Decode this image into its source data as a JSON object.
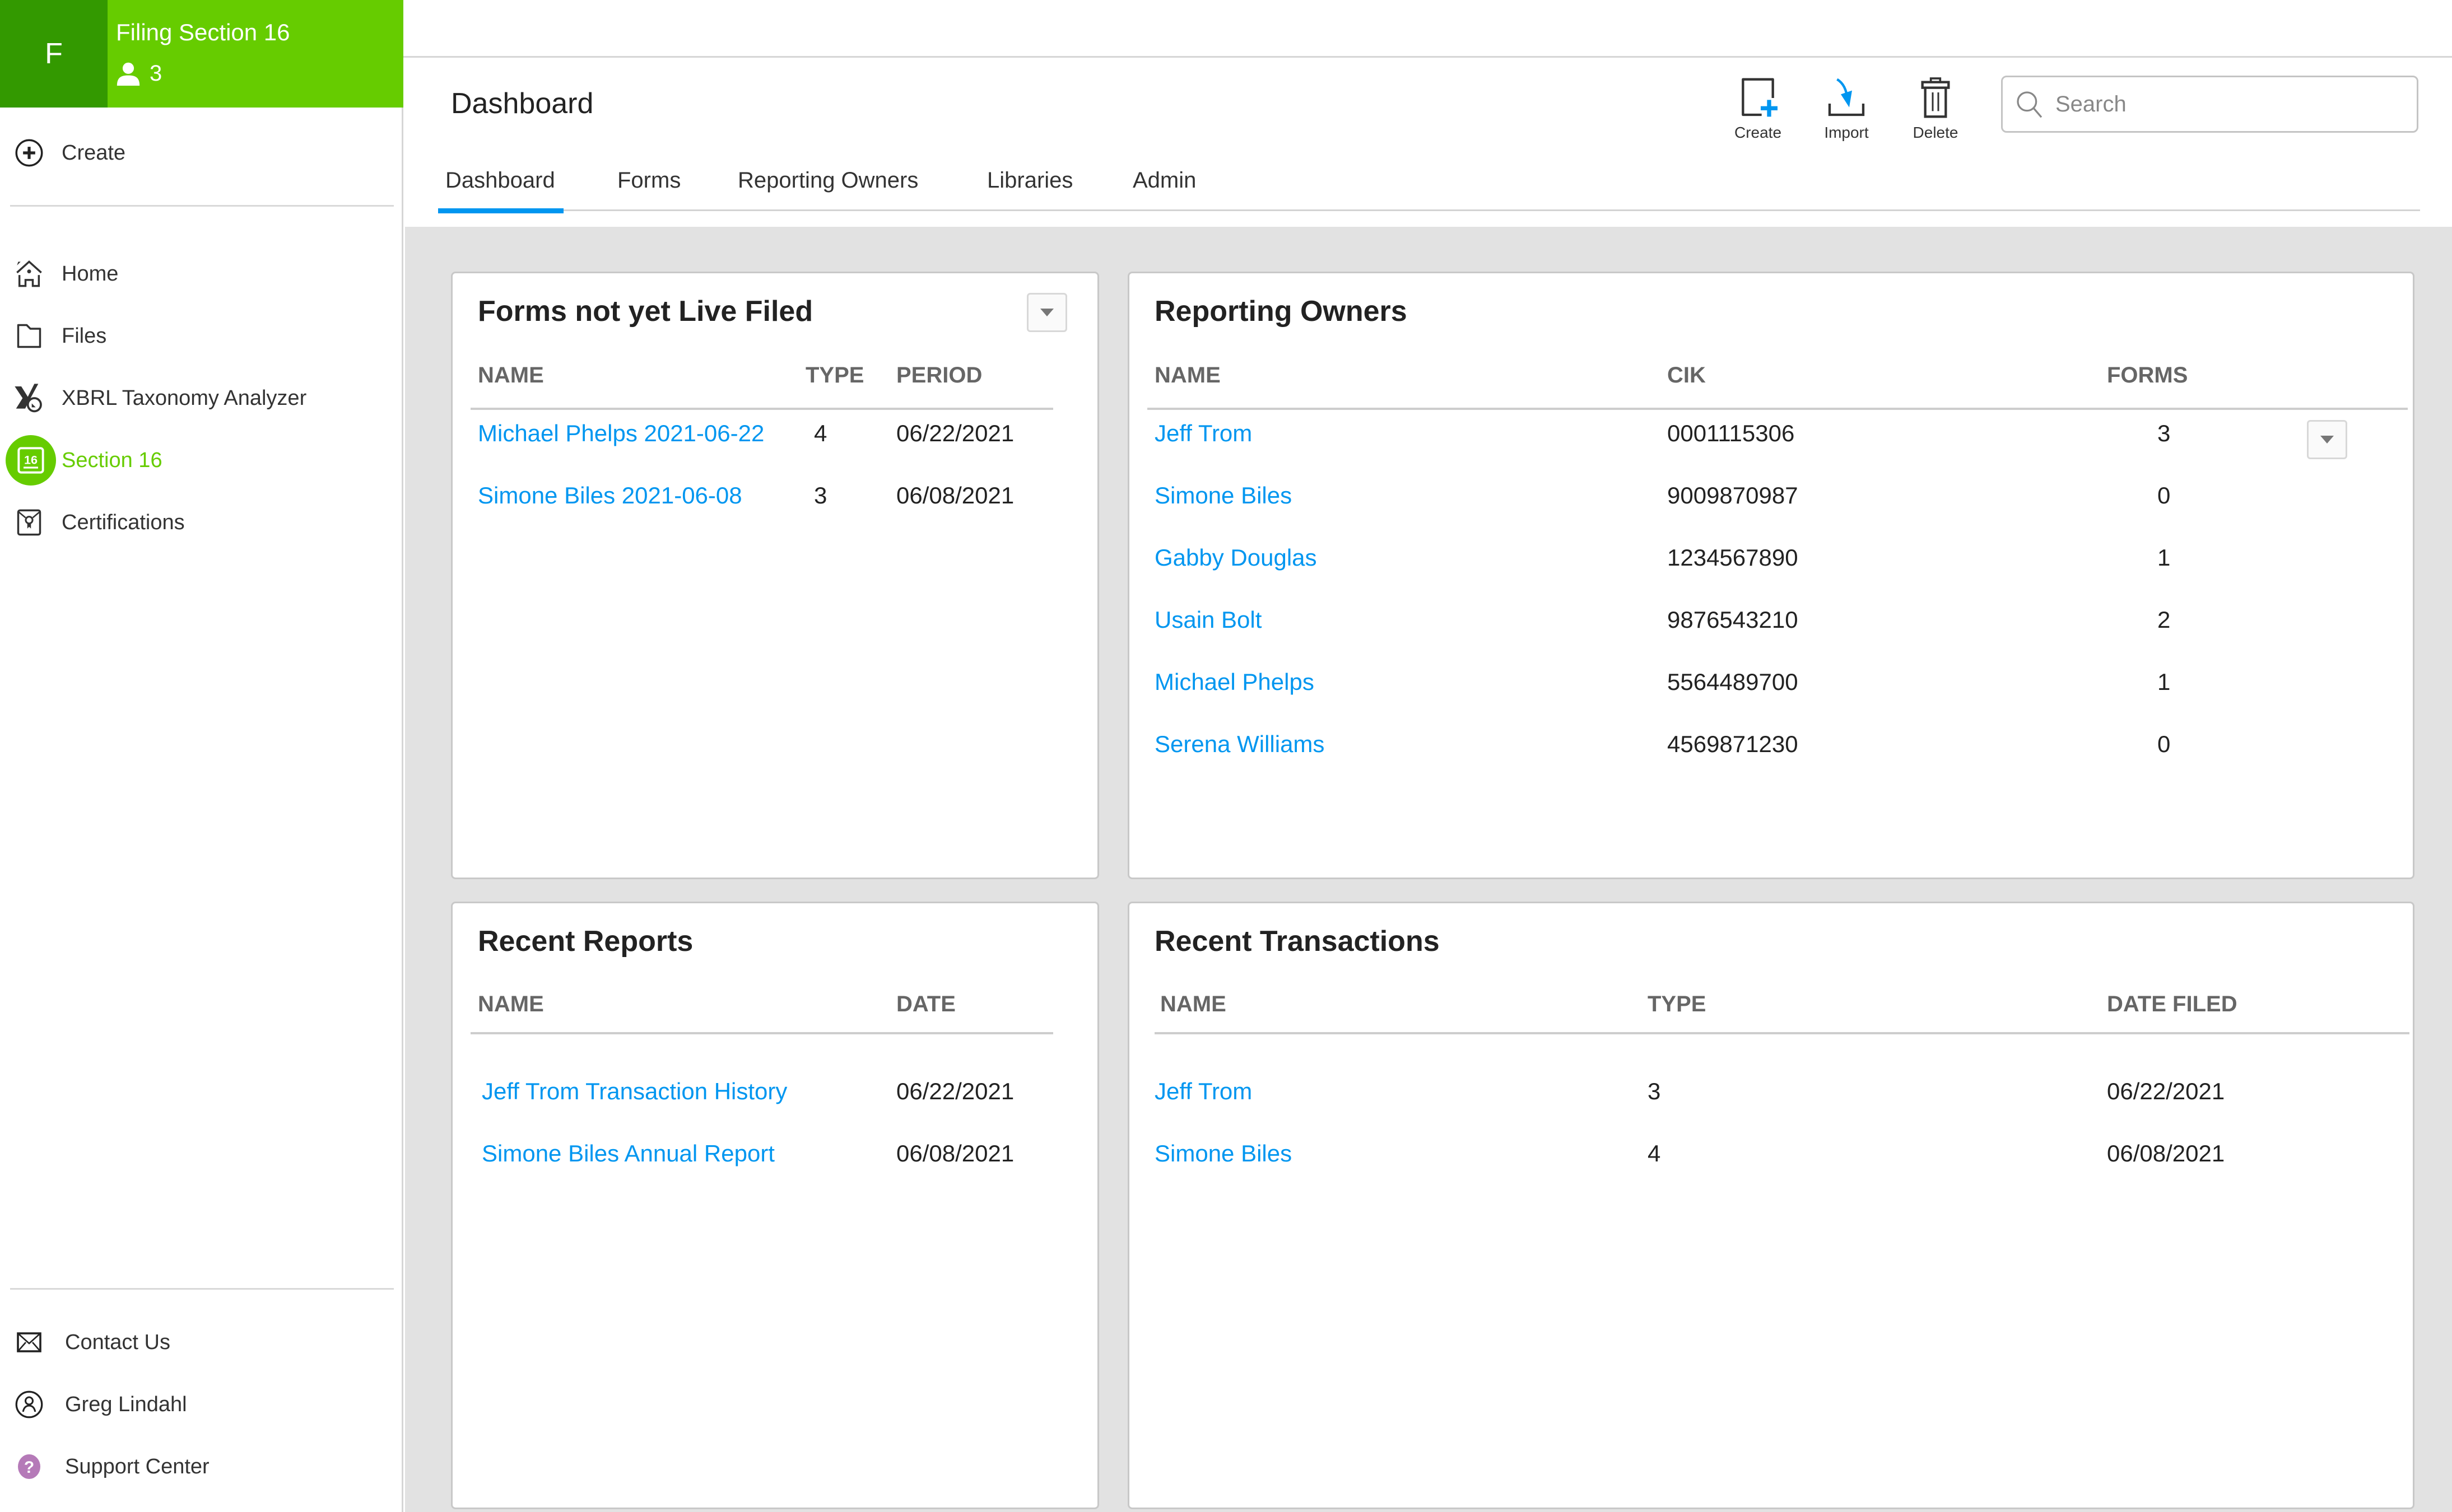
{
  "brand": {
    "letter": "F",
    "title": "Filing Section 16",
    "user_count": "3",
    "colors": {
      "dark": "#339900",
      "light": "#66cc00"
    }
  },
  "sidebar": {
    "create_label": "Create",
    "items": [
      {
        "label": "Home",
        "icon": "home-icon"
      },
      {
        "label": "Files",
        "icon": "folder-icon"
      },
      {
        "label": "XBRL Taxonomy Analyzer",
        "icon": "xbrl-analyzer-icon"
      },
      {
        "label": "Section 16",
        "icon": "section-16-icon",
        "active": true
      },
      {
        "label": "Certifications",
        "icon": "certificate-icon"
      }
    ],
    "footer": [
      {
        "label": "Contact Us",
        "icon": "envelope-icon"
      },
      {
        "label": "Greg Lindahl",
        "icon": "user-circle-icon"
      },
      {
        "label": "Support Center",
        "icon": "help-icon"
      }
    ]
  },
  "header": {
    "title": "Dashboard",
    "toolbar": {
      "create": "Create",
      "import": "Import",
      "delete": "Delete"
    },
    "search_placeholder": "Search",
    "tabs": [
      "Dashboard",
      "Forms",
      "Reporting Owners",
      "Libraries",
      "Admin"
    ],
    "active_tab": "Dashboard",
    "accent": "#0096f0"
  },
  "panels": {
    "forms_not_filed": {
      "title": "Forms not yet Live Filed",
      "columns": [
        "NAME",
        "TYPE",
        "PERIOD"
      ],
      "rows": [
        {
          "name": "Michael Phelps 2021-06-22",
          "type": "4",
          "period": "06/22/2021"
        },
        {
          "name": "Simone Biles 2021-06-08",
          "type": "3",
          "period": "06/08/2021"
        }
      ]
    },
    "reporting_owners": {
      "title": "Reporting Owners",
      "columns": [
        "NAME",
        "CIK",
        "FORMS"
      ],
      "rows": [
        {
          "name": "Jeff Trom",
          "cik": "0001115306",
          "forms": "3"
        },
        {
          "name": "Simone Biles",
          "cik": "9009870987",
          "forms": "0"
        },
        {
          "name": "Gabby Douglas",
          "cik": "1234567890",
          "forms": "1"
        },
        {
          "name": "Usain Bolt",
          "cik": "9876543210",
          "forms": "2"
        },
        {
          "name": "Michael Phelps",
          "cik": "5564489700",
          "forms": "1"
        },
        {
          "name": "Serena Williams",
          "cik": "4569871230",
          "forms": "0"
        }
      ]
    },
    "recent_reports": {
      "title": "Recent Reports",
      "columns": [
        "NAME",
        "DATE"
      ],
      "rows": [
        {
          "name": "Jeff Trom Transaction History",
          "date": "06/22/2021"
        },
        {
          "name": "Simone Biles Annual Report",
          "date": "06/08/2021"
        }
      ]
    },
    "recent_transactions": {
      "title": "Recent Transactions",
      "columns": [
        "NAME",
        "TYPE",
        "DATE FILED"
      ],
      "rows": [
        {
          "name": "Jeff Trom",
          "type": "3",
          "date_filed": "06/22/2021"
        },
        {
          "name": "Simone Biles",
          "type": "4",
          "date_filed": "06/08/2021"
        }
      ]
    }
  }
}
